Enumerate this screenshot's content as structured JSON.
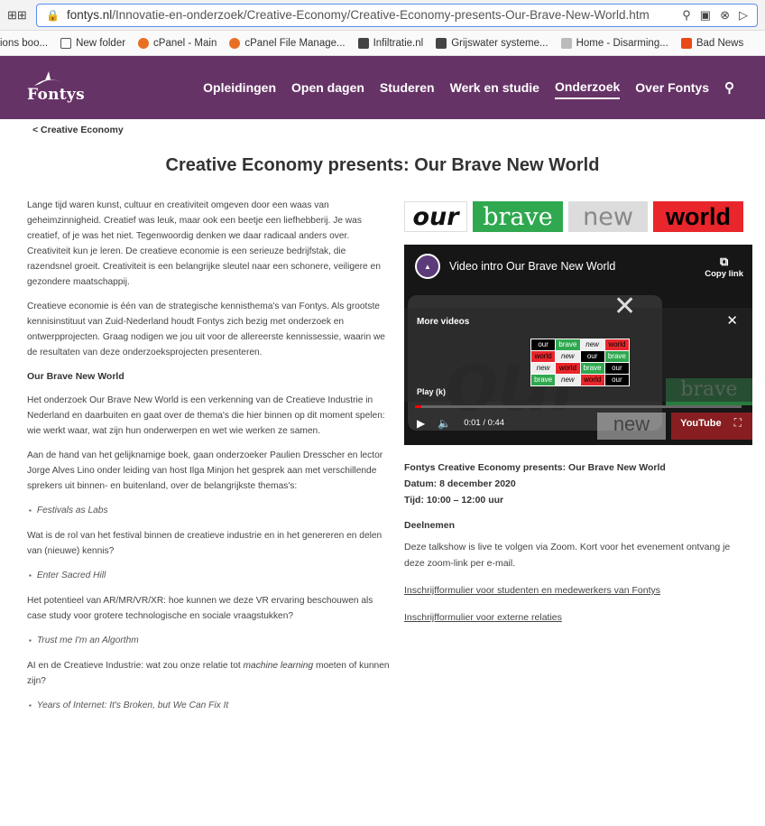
{
  "browser": {
    "url_host": "fontys.nl",
    "url_path": "/Innovatie-en-onderzoek/Creative-Economy/Creative-Economy-presents-Our-Brave-New-World.htm",
    "bookmarks": [
      {
        "label": "ions boo...",
        "icon": "none"
      },
      {
        "label": "New folder",
        "icon": "folder-icon"
      },
      {
        "label": "cPanel - Main",
        "icon": "cpanel-icon"
      },
      {
        "label": "cPanel File Manage...",
        "icon": "cpanel-icon"
      },
      {
        "label": "Infiltratie.nl",
        "icon": "document-icon"
      },
      {
        "label": "Grijswater systeme...",
        "icon": "document-icon"
      },
      {
        "label": "Home - Disarming...",
        "icon": "site-icon"
      },
      {
        "label": "Bad News",
        "icon": "badnews-icon"
      }
    ]
  },
  "header": {
    "logo_text": "Fontys",
    "nav": [
      "Opleidingen",
      "Open dagen",
      "Studeren",
      "Werk en studie",
      "Onderzoek",
      "Over Fontys"
    ],
    "active_nav": "Onderzoek",
    "brand_color": "#663366"
  },
  "breadcrumb": "< Creative Economy",
  "title": "Creative Economy presents: Our Brave New World",
  "article": {
    "p1": "Lange tijd waren kunst, cultuur en creativiteit omgeven door een waas van geheimzinnigheid. Creatief was leuk, maar ook een beetje een liefhebberij. Je was creatief, of je was het niet. Tegenwoordig denken we daar radicaal anders over. Creativiteit kun je leren. De creatieve economie is een serieuze bedrijfstak, die razendsnel groeit. Creativiteit is een belangrijke sleutel naar een schonere, veiligere en gezondere maatschappij.",
    "p2": "Creatieve economie is één van de strategische kennisthema's van Fontys. Als grootste kennisinstituut van Zuid-Nederland houdt Fontys zich bezig met onderzoek en ontwerpprojecten. Graag nodigen we jou uit voor de allereerste kennissessie, waarin we de resultaten van deze onderzoeksprojecten presenteren.",
    "h1": "Our Brave New World",
    "p3": "Het onderzoek Our Brave New World is een verkenning van de Creatieve Industrie in Nederland en daarbuiten en gaat over de thema's die hier binnen op dit moment spelen: wie werkt waar, wat zijn hun onderwerpen en wet wie werken ze samen.",
    "p4": "Aan de hand van het gelijknamige boek, gaan onderzoeker Paulien Dresscher en lector Jorge Alves Lino onder leiding van host Ilga Minjon het gesprek aan met verschillende sprekers uit binnen- en buitenland, over de belangrijkste themas's:",
    "b1": "Festivals as Labs",
    "p5": "Wat is de rol van het festival binnen de creatieve industrie en in het genereren en delen van (nieuwe) kennis?",
    "b2": "Enter Sacred Hill",
    "p6": "Het potentieel van AR/MR/VR/XR: hoe kunnen we deze VR ervaring beschouwen als case study voor grotere technologische en sociale vraagstukken?",
    "b3": "Trust me I'm an Algorthm",
    "p7a": "AI en de Creatieve Industrie: wat zou onze relatie tot ",
    "p7em": "machine learning",
    "p7b": " moeten of kunnen zijn?",
    "b4": "Years of Internet: It's Broken, but We Can Fix It"
  },
  "brand_strip": {
    "w1": "our",
    "w2": "brave",
    "w3": "new",
    "w4": "world"
  },
  "video": {
    "title": "Video intro Our Brave New World",
    "copy_label": "Copy link",
    "more_videos": "More videos",
    "play_hint": "Play (k)",
    "time": "0:01 / 0:44",
    "youtube": "YouTube",
    "watermark": "our",
    "thumb_words": [
      "our",
      "brave",
      "new",
      "world",
      "world",
      "new",
      "our",
      "brave",
      "new",
      "world",
      "brave",
      "our",
      "brave",
      "new",
      "world",
      "our"
    ],
    "bg_words": {
      "brave": "brave",
      "new": "new"
    },
    "progress": 0.02
  },
  "event": {
    "title": "Fontys Creative Economy presents: Our Brave New World",
    "date": "Datum: 8 december 2020",
    "time": "Tijd: 10:00 – 12:00 uur",
    "join_heading": "Deelnemen",
    "join_text": "Deze talkshow is live te volgen via Zoom. Kort voor het evenement ontvang je deze zoom-link per e-mail.",
    "link1": "Inschrijfformulier voor studenten en medewerkers van Fontys",
    "link2": "Inschrijfformulier voor externe relaties"
  }
}
